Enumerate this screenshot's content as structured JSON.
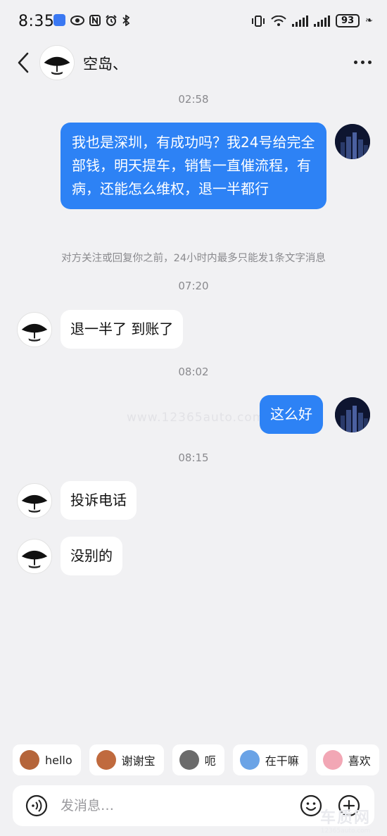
{
  "status_bar": {
    "time": "8:35",
    "left_icons": [
      "app-badge-icon",
      "eye-icon",
      "nfc-icon",
      "alarm-icon",
      "bluetooth-icon"
    ],
    "right_icons": [
      "vibrate-icon",
      "wifi-icon",
      "signal-icon",
      "signal-icon"
    ],
    "battery": "93"
  },
  "header": {
    "contact_name": "空岛、",
    "back_icon": "chevron-left-icon",
    "more_icon": "more-dots-icon"
  },
  "messages": [
    {
      "type": "timestamp",
      "text": "02:58"
    },
    {
      "type": "outgoing",
      "text": "我也是深圳，有成功吗？我24号给完全部钱，明天提车，销售一直催流程，有病，还能怎么维权，退一半都行"
    },
    {
      "type": "notice",
      "text": "对方关注或回复你之前，24小时内最多只能发1条文字消息"
    },
    {
      "type": "timestamp",
      "text": "07:20"
    },
    {
      "type": "incoming",
      "text": "退一半了 到账了"
    },
    {
      "type": "timestamp",
      "text": "08:02"
    },
    {
      "type": "outgoing",
      "text": "这么好"
    },
    {
      "type": "timestamp",
      "text": "08:15"
    },
    {
      "type": "incoming",
      "text": "投诉电话"
    },
    {
      "type": "incoming",
      "text": "没别的"
    }
  ],
  "watermark": "www.12365auto.com",
  "quick_replies": [
    {
      "label": "hello",
      "icon": "monkey-emoji-icon",
      "color": "#b5653a"
    },
    {
      "label": "谢谢宝",
      "icon": "monkey-flower-emoji-icon",
      "color": "#c06a3e"
    },
    {
      "label": "呃",
      "icon": "cat-emoji-icon",
      "color": "#6b6b6b"
    },
    {
      "label": "在干嘛",
      "icon": "rabbit-emoji-icon",
      "color": "#6aa3e6"
    },
    {
      "label": "喜欢",
      "icon": "pig-emoji-icon",
      "color": "#f2a7b5"
    }
  ],
  "input_bar": {
    "placeholder": "发消息…",
    "voice_icon": "voice-icon",
    "emoji_icon": "smiley-icon",
    "plus_icon": "plus-icon"
  },
  "logo_watermark": {
    "line1": "车质网",
    "line2": "12365auto.com"
  },
  "colors": {
    "outgoing_bubble": "#2d82f5",
    "incoming_bubble": "#ffffff",
    "background": "#f1f1f3",
    "timestamp_text": "#8a8a8e"
  }
}
